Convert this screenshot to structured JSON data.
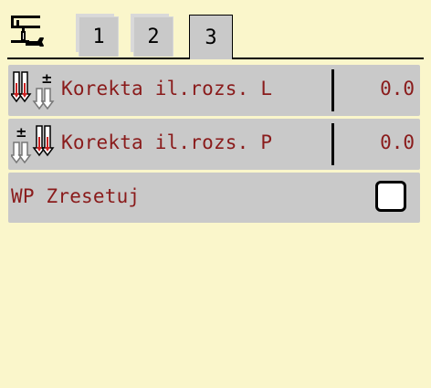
{
  "tabs": [
    {
      "label": "1",
      "active": false
    },
    {
      "label": "2",
      "active": false
    },
    {
      "label": "3",
      "active": true
    }
  ],
  "rows": [
    {
      "icon": "spread-correction-left-icon",
      "label": "Korekta il.rozs. L",
      "value": "0.0"
    },
    {
      "icon": "spread-correction-right-icon",
      "label": "Korekta il.rozs. P",
      "value": "0.0"
    },
    {
      "label": "WP Zresetuj",
      "checked": false
    }
  ],
  "colors": {
    "background": "#faf6cb",
    "row_background": "#c9c9c9",
    "text": "#8a1b1b",
    "accent": "#cc2222"
  }
}
